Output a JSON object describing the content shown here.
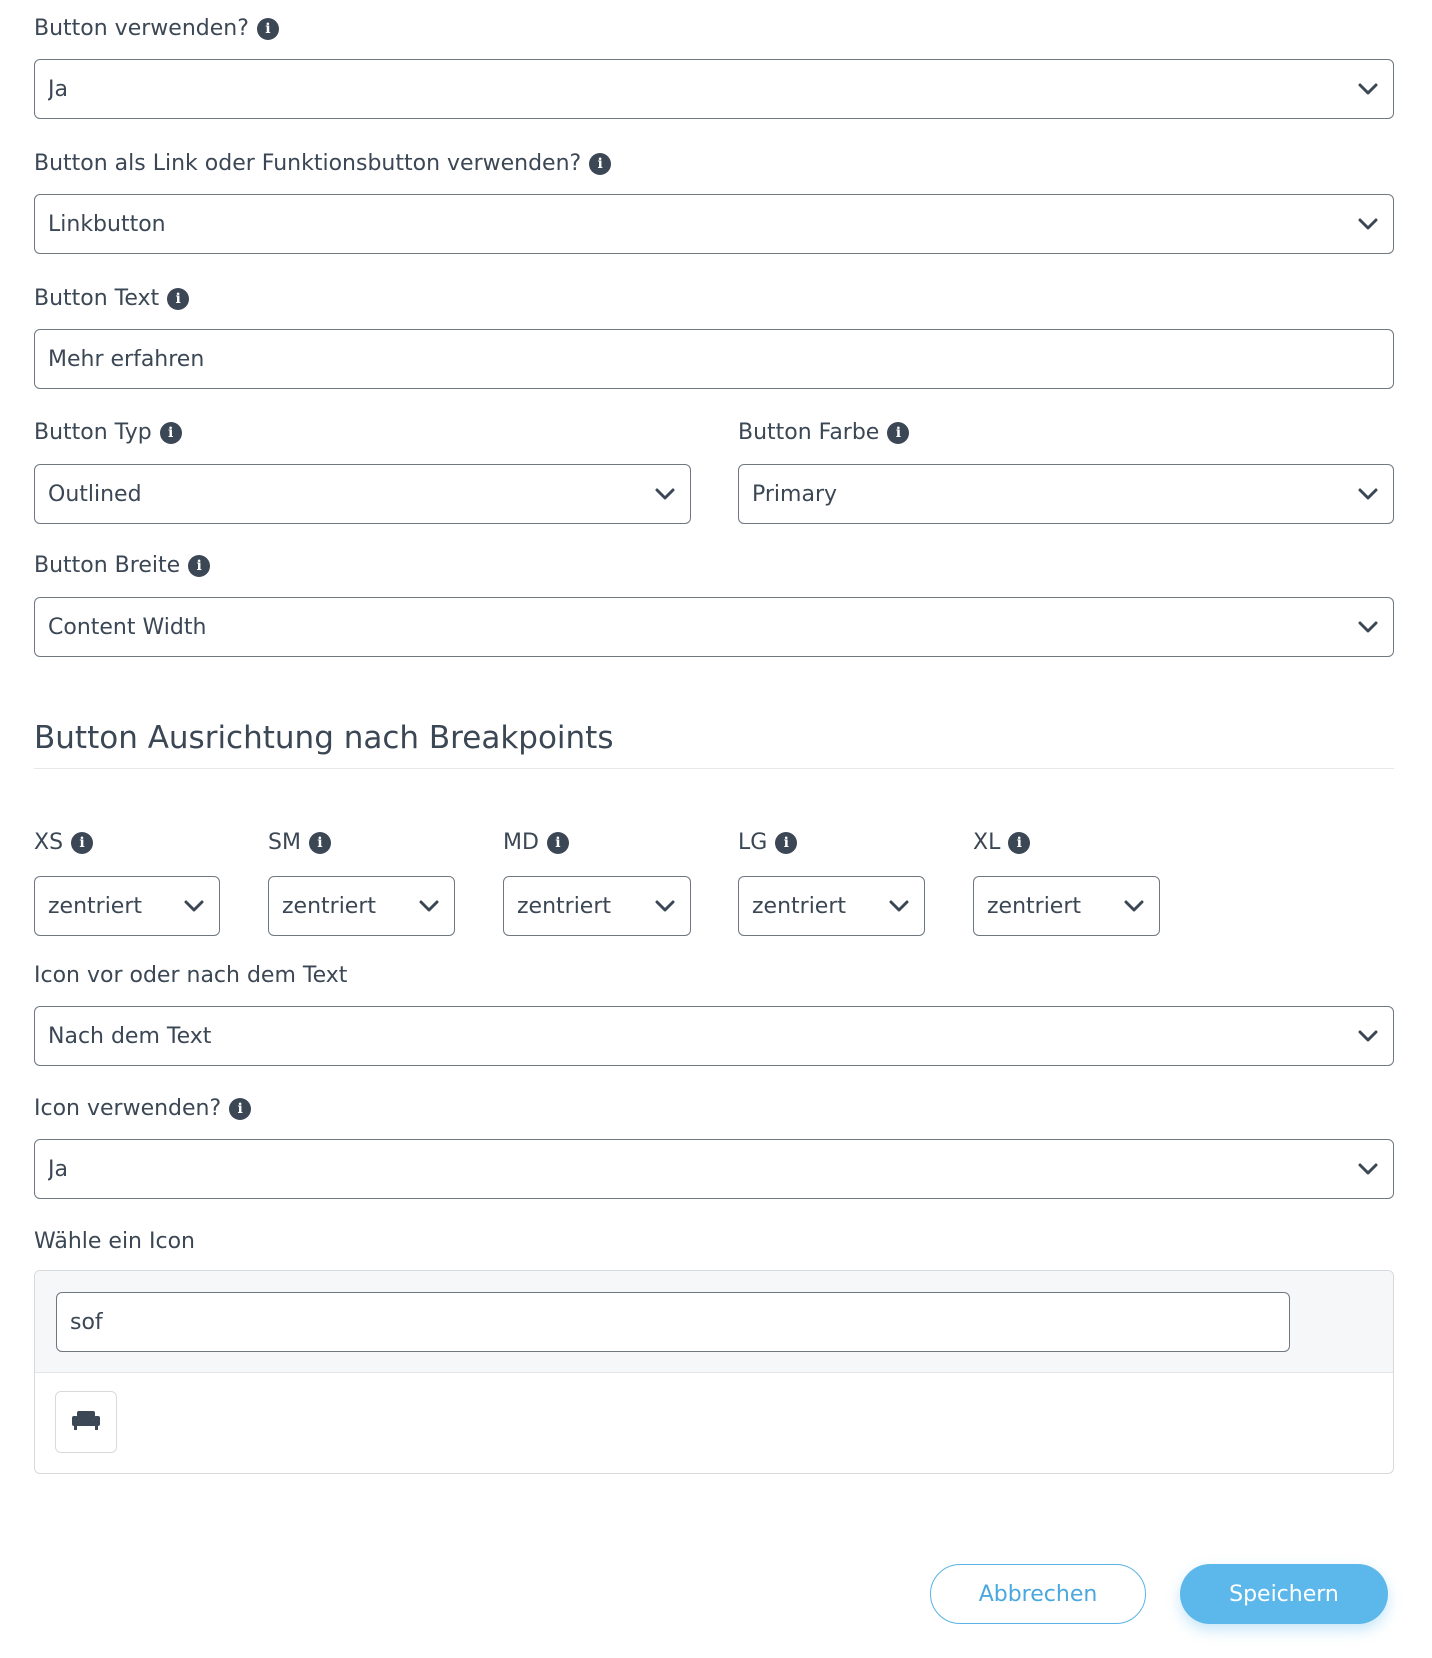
{
  "button_use": {
    "label": "Button verwenden?",
    "value": "Ja"
  },
  "button_kind": {
    "label": "Button als Link oder Funktionsbutton verwenden?",
    "value": "Linkbutton"
  },
  "button_text": {
    "label": "Button Text",
    "value": "Mehr erfahren"
  },
  "button_type": {
    "label": "Button Typ",
    "value": "Outlined"
  },
  "button_color": {
    "label": "Button Farbe",
    "value": "Primary"
  },
  "button_width": {
    "label": "Button Breite",
    "value": "Content Width"
  },
  "alignment": {
    "title": "Button Ausrichtung nach Breakpoints",
    "breakpoints": [
      {
        "label": "XS",
        "value": "zentriert"
      },
      {
        "label": "SM",
        "value": "zentriert"
      },
      {
        "label": "MD",
        "value": "zentriert"
      },
      {
        "label": "LG",
        "value": "zentriert"
      },
      {
        "label": "XL",
        "value": "zentriert"
      }
    ]
  },
  "icon_position": {
    "label": "Icon vor oder nach dem Text",
    "value": "Nach dem Text"
  },
  "icon_use": {
    "label": "Icon verwenden?",
    "value": "Ja"
  },
  "icon_picker": {
    "label": "Wähle ein Icon",
    "search_value": "sof",
    "results": [
      "couch-icon"
    ]
  },
  "actions": {
    "cancel_label": "Abbrechen",
    "save_label": "Speichern"
  },
  "colors": {
    "text": "#3b4754",
    "accent": "#5cb8ea",
    "border": "#6f7780"
  }
}
